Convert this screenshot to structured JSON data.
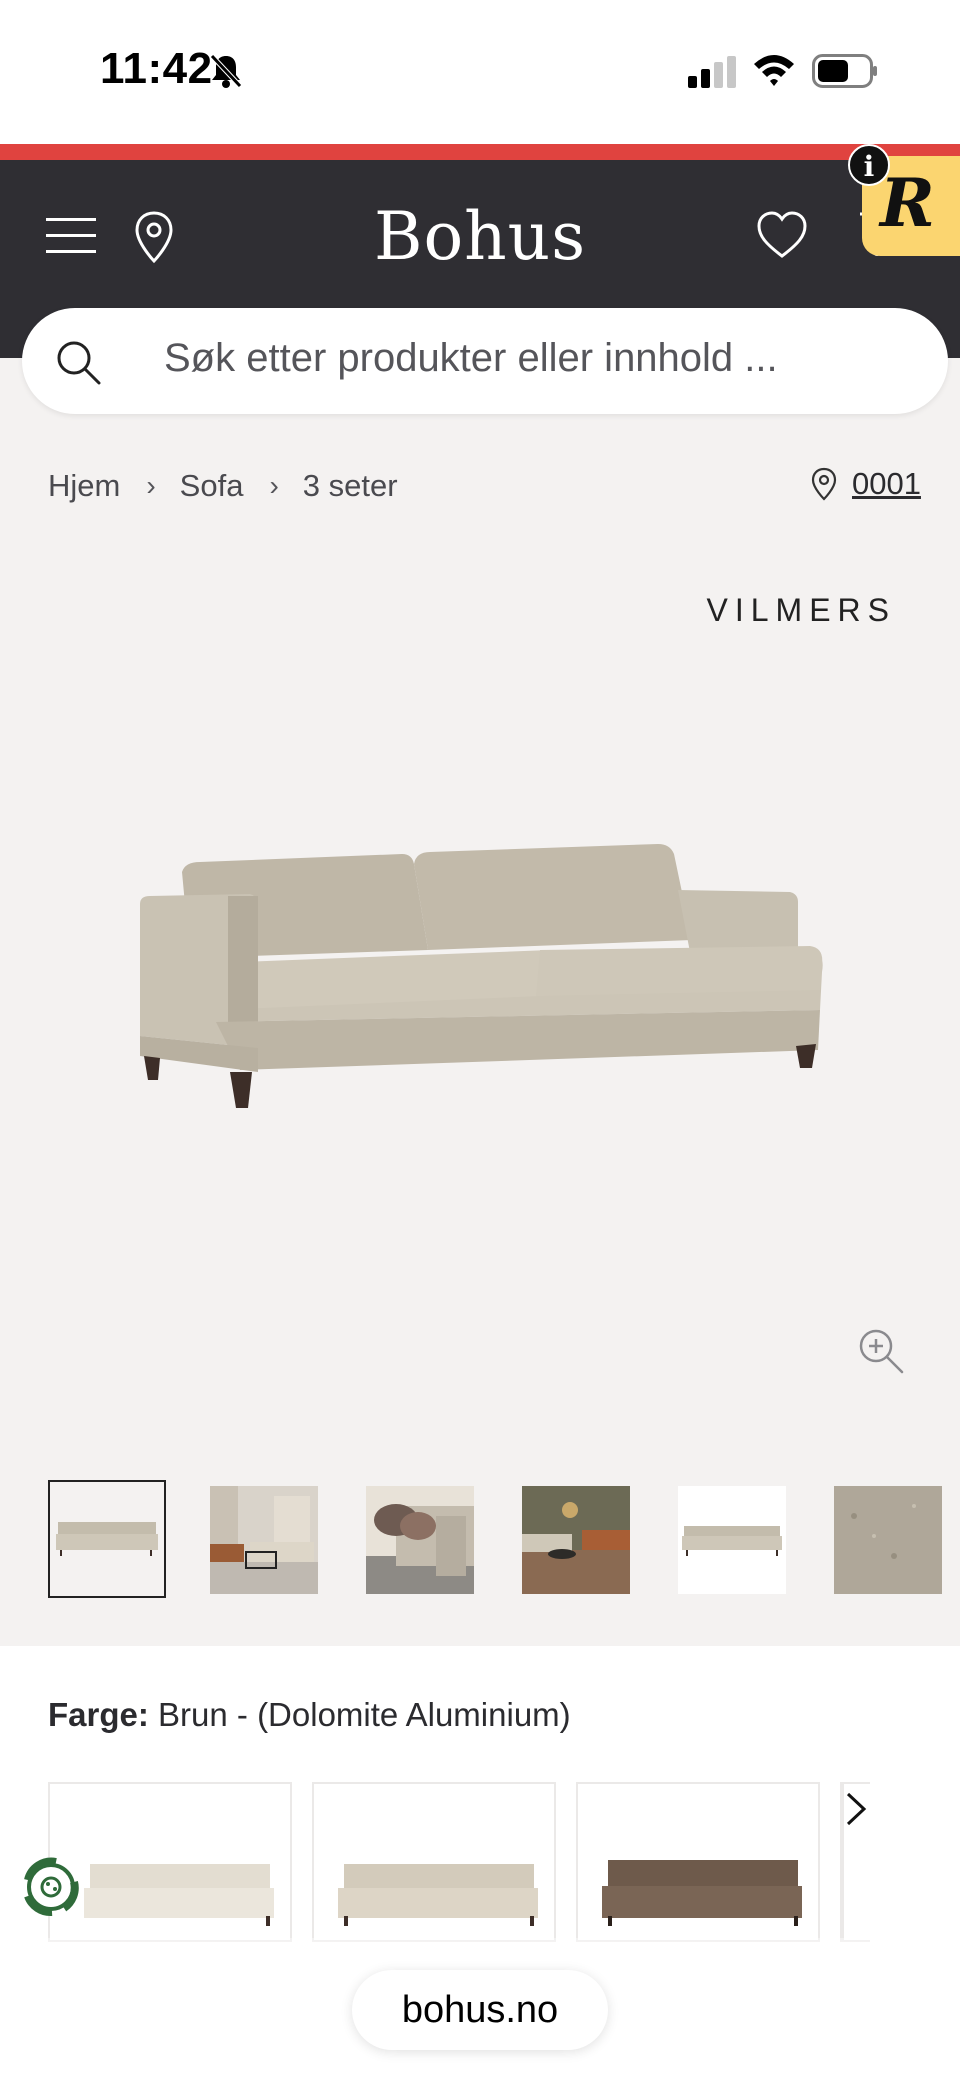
{
  "status_bar": {
    "time": "11:42"
  },
  "header": {
    "logo": "Bohus",
    "badge_letter": "R",
    "info": "i"
  },
  "search": {
    "placeholder": "Søk etter produkter eller innhold ..."
  },
  "breadcrumb": {
    "items": [
      "Hjem",
      "Sofa",
      "3 seter"
    ],
    "store_number": "0001"
  },
  "product": {
    "brand": "VILMERS"
  },
  "thumbnails": {
    "count": 6,
    "active_index": 0
  },
  "color_selector": {
    "label": "Farge:",
    "value": "Brun - (Dolomite Aluminium)",
    "swatches": [
      {
        "name": "off-white",
        "color": "#ebe6dc"
      },
      {
        "name": "beige",
        "color": "#ddd5c6"
      },
      {
        "name": "brown",
        "color": "#7a6555"
      }
    ]
  },
  "browser": {
    "url": "bohus.no"
  },
  "colors": {
    "header_bg": "#2f2e33",
    "accent_red": "#e0433f",
    "badge_yellow": "#fbd570",
    "page_bg": "#f4f2f1"
  }
}
